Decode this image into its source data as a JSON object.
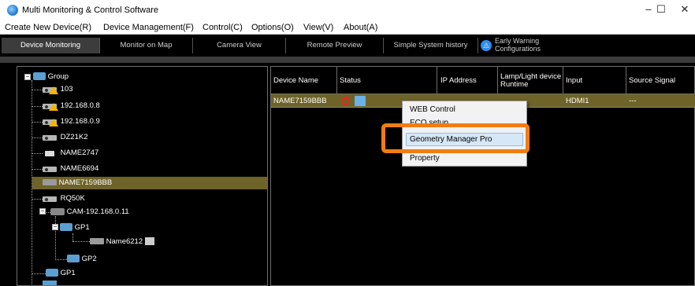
{
  "window": {
    "title": "Multi Monitoring & Control Software",
    "minimize_glyph": "–",
    "maximize_glyph": "☐",
    "close_glyph": "✕"
  },
  "menu": [
    "Create New Device(R)",
    "Device Management(F)",
    "Control(C)",
    "Options(O)",
    "View(V)",
    "About(A)"
  ],
  "tabs": {
    "device_monitoring": "Device Monitoring",
    "monitor_on_map": "Monitor on Map",
    "camera_view": "Camera View",
    "remote_preview": "Remote Preview",
    "simple_system_history": "Simple System history",
    "early_warning_line1": "Early Warning",
    "early_warning_line2": "Configurations"
  },
  "tree": {
    "group": "Group",
    "items": {
      "d103": "103",
      "d1": "192.168.0.8",
      "d2": "192.168.0.9",
      "dz": "DZ21K2",
      "n2747": "NAME2747",
      "n6694": "NAME6694",
      "n7159": "NAME7159BBB",
      "rq": "RQ50K",
      "cam": "CAM-192.168.0.11",
      "gp1": "GP1",
      "n6212": "Name6212",
      "gp2": "GP2",
      "gp1b": "GP1"
    }
  },
  "grid": {
    "headers": {
      "device_name": "Device Name",
      "status": "Status",
      "ip": "IP Address",
      "lamp": "Lamp/Light device Runtime",
      "input": "Input",
      "source": "Source Signal"
    },
    "row": {
      "name": "NAME7159BBB",
      "input": "HDMI1",
      "source": "---"
    }
  },
  "context_menu": {
    "web_control": "WEB Control",
    "eco_setup": "ECO setup",
    "geometry": "Geometry Manager Pro",
    "property": "Property"
  },
  "colors": {
    "selection": "#6e6328",
    "callout": "#f07d12",
    "power_off": "#e8281e"
  }
}
